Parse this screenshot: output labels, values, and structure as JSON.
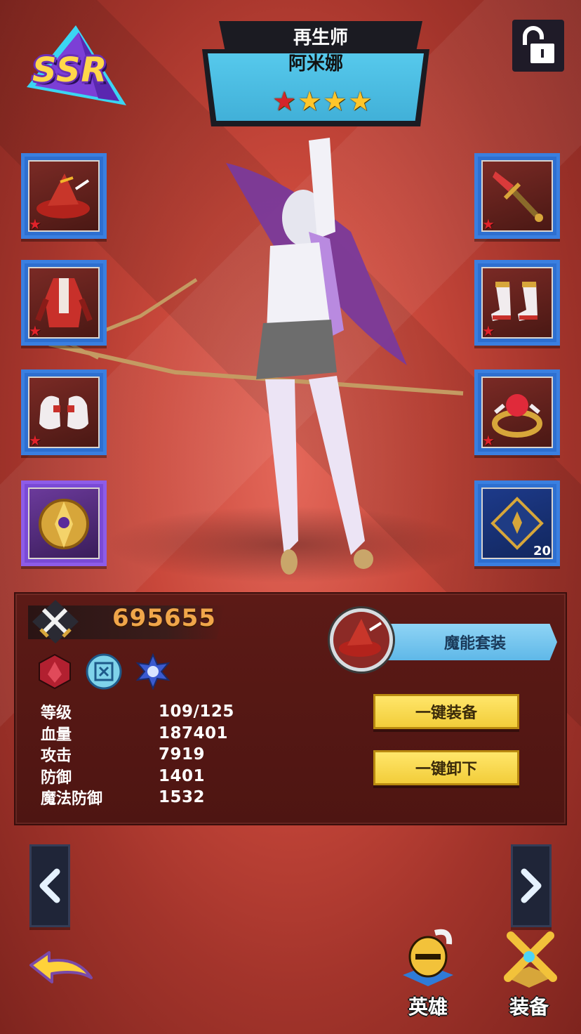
{
  "hero": {
    "rarity": "SSR",
    "class": "再生师",
    "name": "阿米娜",
    "stars_total": 4,
    "stars_red": 1
  },
  "equipment": {
    "left": [
      {
        "name": "hat-slot",
        "icon": "witch-hat-icon",
        "stars": 1
      },
      {
        "name": "armor-slot",
        "icon": "robe-armor-icon",
        "stars": 1
      },
      {
        "name": "gloves-slot",
        "icon": "gloves-icon",
        "stars": 1
      },
      {
        "name": "emblem-slot",
        "icon": "golden-emblem-icon"
      }
    ],
    "right": [
      {
        "name": "weapon-slot",
        "icon": "sword-icon",
        "stars": 1
      },
      {
        "name": "boots-slot",
        "icon": "boots-icon",
        "stars": 1
      },
      {
        "name": "ring-slot",
        "icon": "ring-icon",
        "stars": 1
      },
      {
        "name": "rune-slot",
        "icon": "rune-emblem-icon",
        "count": "20"
      }
    ]
  },
  "panel": {
    "power": "695655",
    "set_name": "魔能套装",
    "equip_all": "一键装备",
    "unequip_all": "一键卸下",
    "stats": [
      {
        "label": "等级",
        "value": "109/125"
      },
      {
        "label": "血量",
        "value": "187401"
      },
      {
        "label": "攻击",
        "value": "7919"
      },
      {
        "label": "防御",
        "value": "1401"
      },
      {
        "label": "魔法防御",
        "value": "1532"
      }
    ]
  },
  "bottom": {
    "hero_label": "英雄",
    "equip_label": "装备"
  },
  "colors": {
    "accent_blue": "#3a7fe0",
    "gold": "#f0a64a",
    "button_yellow": "#f2cd3a",
    "panel_bg": "#5c1a16"
  }
}
